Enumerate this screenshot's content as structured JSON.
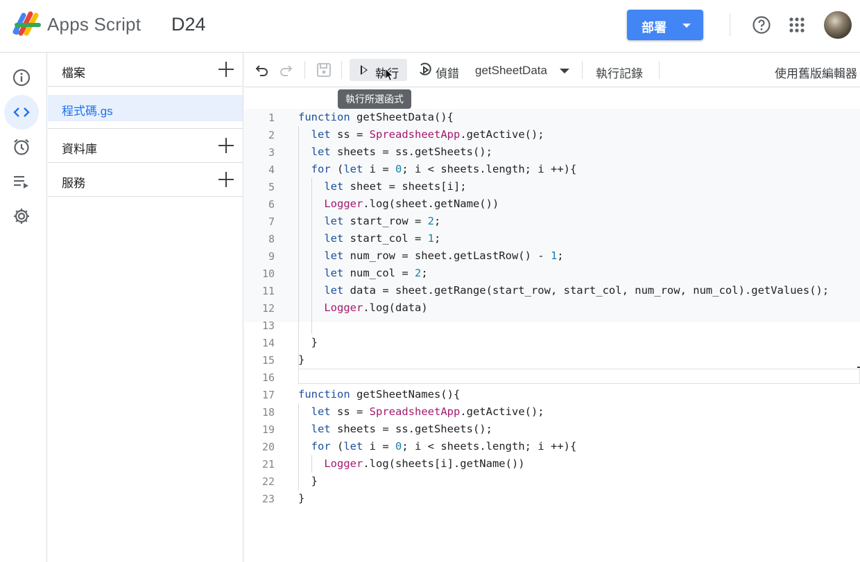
{
  "header": {
    "app_name": "Apps Script",
    "project_name": "D24",
    "deploy_label": "部署",
    "icons": [
      "apps-script-logo",
      "help-icon",
      "apps-grid-icon",
      "avatar"
    ]
  },
  "rail": {
    "items": [
      "info-icon",
      "code-icon",
      "clock-icon",
      "executions-icon",
      "gear-icon"
    ],
    "active_index": 1
  },
  "files": {
    "header": "檔案",
    "file_name": "程式碼.gs",
    "sections": [
      "資料庫",
      "服務"
    ]
  },
  "toolbar": {
    "run_label": "執行",
    "debug_label": "偵錯",
    "function_name": "getSheetData",
    "log_label": "執行記錄",
    "legacy_label": "使用舊版編輯器"
  },
  "tooltip": "執行所選函式",
  "editor": {
    "line_numbers": [
      "1",
      "2",
      "3",
      "4",
      "5",
      "6",
      "7",
      "8",
      "9",
      "10",
      "11",
      "12",
      "13",
      "14",
      "15",
      "16",
      "17",
      "18",
      "19",
      "20",
      "21",
      "22",
      "23"
    ],
    "current_line": 16
  },
  "colors": {
    "accent": "#4285f4",
    "keyword": "#1a4f9e",
    "class": "#a31a6e",
    "number": "#1a7fa8",
    "selection": "#e8f0fe"
  }
}
